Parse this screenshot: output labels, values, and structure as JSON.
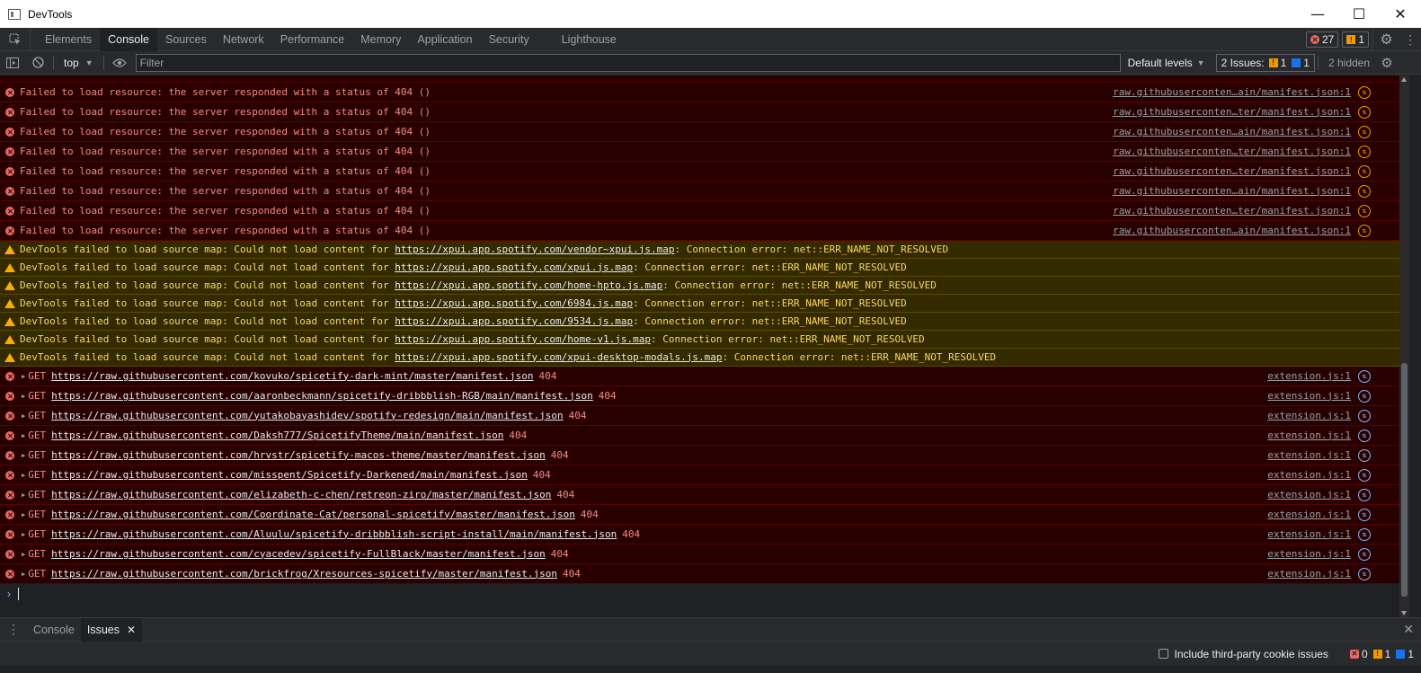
{
  "window": {
    "title": "DevTools",
    "min_label": "—",
    "max_label": "☐",
    "close_label": "✕"
  },
  "main_tabs": [
    "Elements",
    "Console",
    "Sources",
    "Network",
    "Performance",
    "Memory",
    "Application",
    "Security",
    "Lighthouse"
  ],
  "active_tab": "Console",
  "counters": {
    "errors": "27",
    "warnings": "1"
  },
  "toolbar": {
    "context": "top",
    "filter_placeholder": "Filter",
    "levels": "Default levels",
    "issues_label": "2 Issues:",
    "issues_warn": "1",
    "issues_info": "1",
    "hidden": "2 hidden"
  },
  "colors": {
    "error_bg": "#290000",
    "error_text": "#f28b82",
    "warning_bg": "#332a00",
    "warning_text": "#fdd663",
    "accent": "#8ab4f8"
  },
  "error_rows": [
    {
      "text": "Failed to load resource: the server responded with a status of 404 ()",
      "source": "raw.githubuserconten…ain/manifest.json:1"
    },
    {
      "text": "Failed to load resource: the server responded with a status of 404 ()",
      "source": "raw.githubuserconten…ter/manifest.json:1"
    },
    {
      "text": "Failed to load resource: the server responded with a status of 404 ()",
      "source": "raw.githubuserconten…ain/manifest.json:1"
    },
    {
      "text": "Failed to load resource: the server responded with a status of 404 ()",
      "source": "raw.githubuserconten…ter/manifest.json:1"
    },
    {
      "text": "Failed to load resource: the server responded with a status of 404 ()",
      "source": "raw.githubuserconten…ter/manifest.json:1"
    },
    {
      "text": "Failed to load resource: the server responded with a status of 404 ()",
      "source": "raw.githubuserconten…ain/manifest.json:1"
    },
    {
      "text": "Failed to load resource: the server responded with a status of 404 ()",
      "source": "raw.githubuserconten…ter/manifest.json:1"
    },
    {
      "text": "Failed to load resource: the server responded with a status of 404 ()",
      "source": "raw.githubuserconten…ain/manifest.json:1"
    }
  ],
  "warning_rows": [
    {
      "prefix": "DevTools failed to load source map: Could not load content for ",
      "url": "https://xpui.app.spotify.com/vendor~xpui.js.map",
      "suffix": ": Connection error: net::ERR_NAME_NOT_RESOLVED"
    },
    {
      "prefix": "DevTools failed to load source map: Could not load content for ",
      "url": "https://xpui.app.spotify.com/xpui.js.map",
      "suffix": ": Connection error: net::ERR_NAME_NOT_RESOLVED"
    },
    {
      "prefix": "DevTools failed to load source map: Could not load content for ",
      "url": "https://xpui.app.spotify.com/home-hpto.js.map",
      "suffix": ": Connection error: net::ERR_NAME_NOT_RESOLVED"
    },
    {
      "prefix": "DevTools failed to load source map: Could not load content for ",
      "url": "https://xpui.app.spotify.com/6984.js.map",
      "suffix": ": Connection error: net::ERR_NAME_NOT_RESOLVED"
    },
    {
      "prefix": "DevTools failed to load source map: Could not load content for ",
      "url": "https://xpui.app.spotify.com/9534.js.map",
      "suffix": ": Connection error: net::ERR_NAME_NOT_RESOLVED"
    },
    {
      "prefix": "DevTools failed to load source map: Could not load content for ",
      "url": "https://xpui.app.spotify.com/home-v1.js.map",
      "suffix": ": Connection error: net::ERR_NAME_NOT_RESOLVED"
    },
    {
      "prefix": "DevTools failed to load source map: Could not load content for ",
      "url": "https://xpui.app.spotify.com/xpui-desktop-modals.js.map",
      "suffix": ": Connection error: net::ERR_NAME_NOT_RESOLVED"
    }
  ],
  "get_rows": [
    {
      "method": "GET",
      "url": "https://raw.githubusercontent.com/kovuko/spicetify-dark-mint/master/manifest.json",
      "status": "404",
      "source": "extension.js:1"
    },
    {
      "method": "GET",
      "url": "https://raw.githubusercontent.com/aaronbeckmann/spicetify-dribbblish-RGB/main/manifest.json",
      "status": "404",
      "source": "extension.js:1"
    },
    {
      "method": "GET",
      "url": "https://raw.githubusercontent.com/yutakobayashidev/spotify-redesign/main/manifest.json",
      "status": "404",
      "source": "extension.js:1"
    },
    {
      "method": "GET",
      "url": "https://raw.githubusercontent.com/Daksh777/SpicetifyTheme/main/manifest.json",
      "status": "404",
      "source": "extension.js:1"
    },
    {
      "method": "GET",
      "url": "https://raw.githubusercontent.com/hrvstr/spicetify-macos-theme/master/manifest.json",
      "status": "404",
      "source": "extension.js:1"
    },
    {
      "method": "GET",
      "url": "https://raw.githubusercontent.com/misspent/Spicetify-Darkened/main/manifest.json",
      "status": "404",
      "source": "extension.js:1"
    },
    {
      "method": "GET",
      "url": "https://raw.githubusercontent.com/elizabeth-c-chen/retreon-ziro/master/manifest.json",
      "status": "404",
      "source": "extension.js:1"
    },
    {
      "method": "GET",
      "url": "https://raw.githubusercontent.com/Coordinate-Cat/personal-spicetify/master/manifest.json",
      "status": "404",
      "source": "extension.js:1"
    },
    {
      "method": "GET",
      "url": "https://raw.githubusercontent.com/Aluulu/spicetify-dribbblish-script-install/main/manifest.json",
      "status": "404",
      "source": "extension.js:1"
    },
    {
      "method": "GET",
      "url": "https://raw.githubusercontent.com/cyacedev/spicetify-FullBlack/master/manifest.json",
      "status": "404",
      "source": "extension.js:1"
    },
    {
      "method": "GET",
      "url": "https://raw.githubusercontent.com/brickfrog/Xresources-spicetify/master/manifest.json",
      "status": "404",
      "source": "extension.js:1"
    }
  ],
  "drawer": {
    "tabs": [
      "Console",
      "Issues"
    ],
    "active": "Issues",
    "include_label": "Include third-party cookie issues",
    "errors": "0",
    "warnings": "1",
    "infos": "1"
  }
}
